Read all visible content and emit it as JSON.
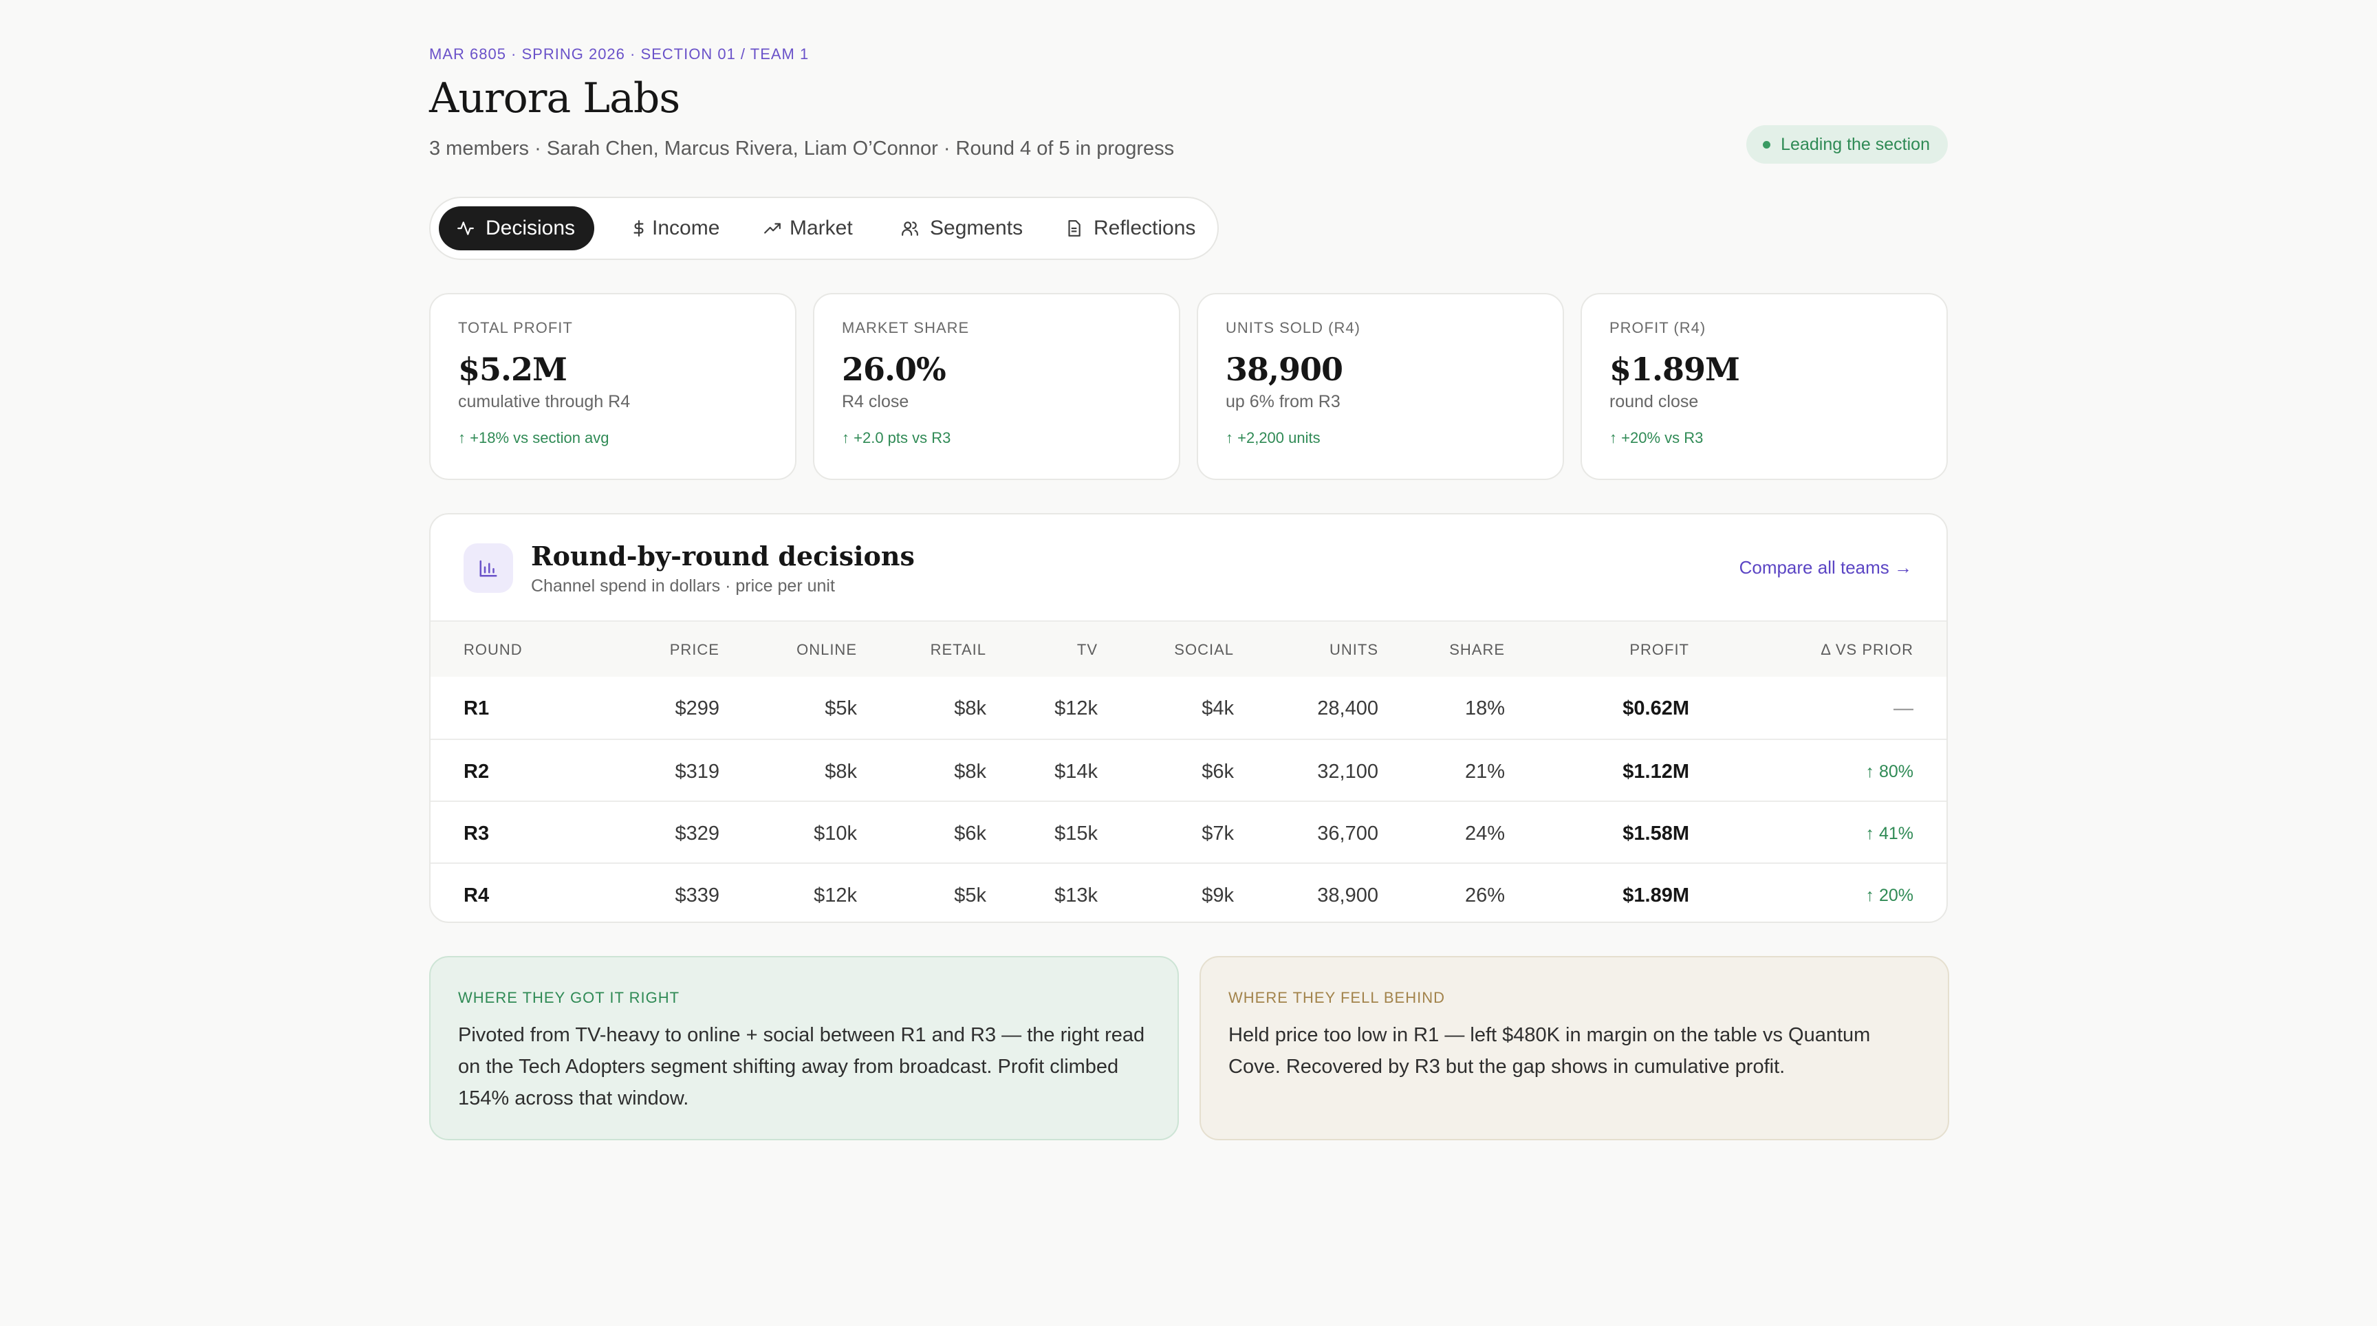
{
  "header": {
    "course": "MAR 6805 · SPRING 2026 · SECTION 01 / TEAM 1",
    "title": "Aurora Labs",
    "members": "3 members · Sarah Chen, Marcus Rivera, Liam O’Connor · Round 4 of 5 in progress",
    "status_badge": "Leading the section"
  },
  "tabs": [
    {
      "label": "Decisions",
      "icon": "activity-icon",
      "active": true
    },
    {
      "label": "Income",
      "icon": "dollar-icon",
      "active": false
    },
    {
      "label": "Market",
      "icon": "trending-up-icon",
      "active": false
    },
    {
      "label": "Segments",
      "icon": "users-icon",
      "active": false
    },
    {
      "label": "Reflections",
      "icon": "document-icon",
      "active": false
    }
  ],
  "kpis": [
    {
      "label": "TOTAL PROFIT",
      "value": "$5.2M",
      "sub": "cumulative through R4",
      "delta": "+18% vs section avg"
    },
    {
      "label": "MARKET SHARE",
      "value": "26.0%",
      "sub": "R4 close",
      "delta": "+2.0 pts vs R3"
    },
    {
      "label": "UNITS SOLD (R4)",
      "value": "38,900",
      "sub": "up 6% from R3",
      "delta": "+2,200 units"
    },
    {
      "label": "PROFIT (R4)",
      "value": "$1.89M",
      "sub": "round close",
      "delta": "+20% vs R3"
    }
  ],
  "decisions": {
    "title": "Round-by-round decisions",
    "subtitle": "Channel spend in dollars · price per unit",
    "compare_link": "Compare all teams →",
    "icon": "bar-chart-icon",
    "columns": [
      "ROUND",
      "PRICE",
      "ONLINE",
      "RETAIL",
      "TV",
      "SOCIAL",
      "UNITS",
      "SHARE",
      "PROFIT",
      "Δ VS PRIOR"
    ],
    "rows": [
      {
        "round": "R1",
        "price": "$299",
        "online": "$5k",
        "retail": "$8k",
        "tv": "$12k",
        "social": "$4k",
        "units": "28,400",
        "share": "18%",
        "profit": "$0.62M",
        "delta": "—"
      },
      {
        "round": "R2",
        "price": "$319",
        "online": "$8k",
        "retail": "$8k",
        "tv": "$14k",
        "social": "$6k",
        "units": "32,100",
        "share": "21%",
        "profit": "$1.12M",
        "delta": "80%"
      },
      {
        "round": "R3",
        "price": "$329",
        "online": "$10k",
        "retail": "$6k",
        "tv": "$15k",
        "social": "$7k",
        "units": "36,700",
        "share": "24%",
        "profit": "$1.58M",
        "delta": "41%"
      },
      {
        "round": "R4",
        "price": "$339",
        "online": "$12k",
        "retail": "$5k",
        "tv": "$13k",
        "social": "$9k",
        "units": "38,900",
        "share": "26%",
        "profit": "$1.89M",
        "delta": "20%"
      }
    ]
  },
  "notes": {
    "right": {
      "label": "WHERE THEY GOT IT RIGHT",
      "text": "Pivoted from TV-heavy to online + social between R1 and R3 — the right read on the Tech Adopters segment shifting away from broadcast. Profit climbed 154% across that window."
    },
    "behind": {
      "label": "WHERE THEY FELL BEHIND",
      "text": "Held price too low in R1 — left $480K in margin on the table vs Quantum Cove. Recovered by R3 but the gap shows in cumulative profit."
    }
  },
  "colors": {
    "accent": "#5b45c4",
    "positive": "#2f8a55",
    "warning_label": "#a2834b",
    "active_tab": "#1c1c1c"
  }
}
